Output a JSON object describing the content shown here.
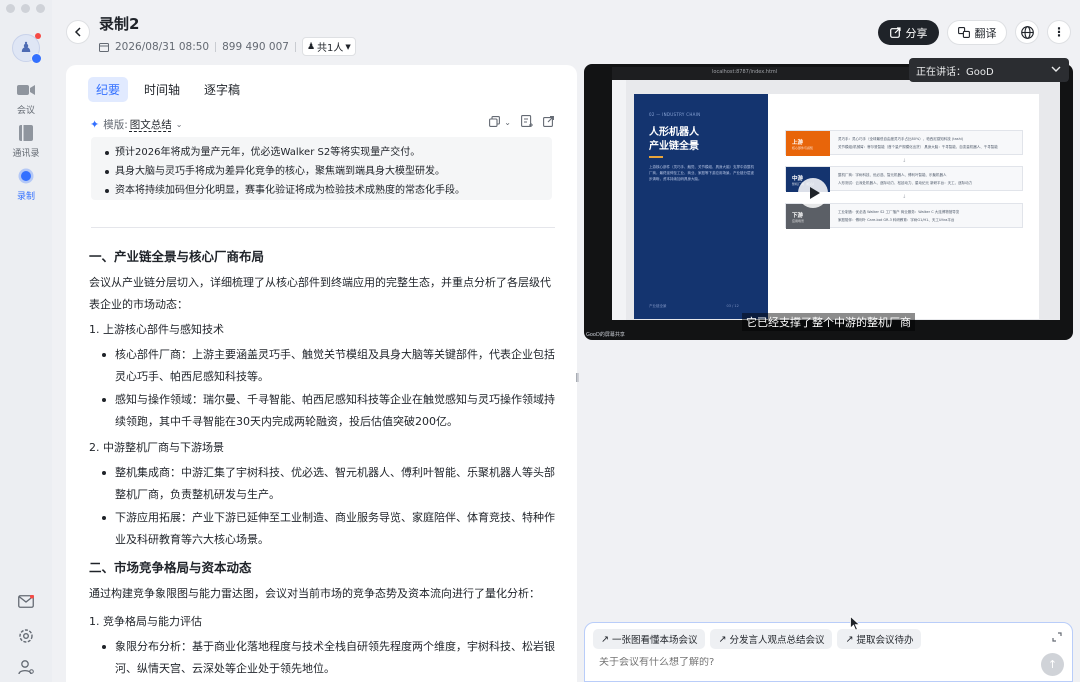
{
  "rail": {
    "items": [
      {
        "label": "会议",
        "icon": "video-camera-icon"
      },
      {
        "label": "通讯录",
        "icon": "contacts-book-icon"
      },
      {
        "label": "录制",
        "icon": "record-dot-icon"
      }
    ]
  },
  "header": {
    "title": "录制2",
    "datetime": "2026/08/31 08:50",
    "meeting_id": "899 490 007",
    "people": "共1人",
    "share_label": "分享",
    "translate_label": "翻译"
  },
  "panel": {
    "tabs": [
      "纪要",
      "时间轴",
      "逐字稿"
    ],
    "template_label": "模版:",
    "template_value": "图文总结",
    "summary": [
      "预计2026年将成为量产元年，优必选Walker S2等将实现量产交付。",
      "具身大脑与灵巧手将成为差异化竞争的核心，聚焦端到端具身大模型研发。",
      "资本将持续加码但分化明显，赛事化验证将成为检验技术成熟度的常态化手段。"
    ],
    "section1": {
      "heading": "一、产业链全景与核心厂商布局",
      "intro": "会议从产业链分层切入，详细梳理了从核心部件到终端应用的完整生态，并重点分析了各层级代表企业的市场动态：",
      "sub1": "1. 上游核心部件与感知技术",
      "sub1_bullets": [
        "核心部件厂商：上游主要涵盖灵巧手、触觉关节模组及具身大脑等关键部件，代表企业包括灵心巧手、帕西尼感知科技等。",
        "感知与操作领域：瑞尔曼、千寻智能、帕西尼感知科技等企业在触觉感知与灵巧操作领域持续领跑，其中千寻智能在30天内完成两轮融资，投后估值突破200亿。"
      ],
      "sub2": "2. 中游整机厂商与下游场景",
      "sub2_bullets": [
        "整机集成商：中游汇集了宇树科技、优必选、智元机器人、傅利叶智能、乐聚机器人等头部整机厂商，负责整机研发与生产。",
        "下游应用拓展：产业下游已延伸至工业制造、商业服务导览、家庭陪伴、体育竞技、特种作业及科研教育等六大核心场景。"
      ]
    },
    "section2": {
      "heading": "二、市场竞争格局与资本动态",
      "intro": "通过构建竞争象限图与能力雷达图，会议对当前市场的竞争态势及资本流向进行了量化分析：",
      "sub1": "1. 竞争格局与能力评估",
      "sub1_bullets": [
        "象限分布分析：基于商业化落地程度与技术全栈自研领先程度两个维度，宇树科技、松岩银河、纵情天宫、云深处等企业处于领先地位。"
      ]
    }
  },
  "video": {
    "url": "localhost:8787/index.html",
    "speaking_label": "正在讲话：GooD",
    "subtitle": "它已经支撑了整个中游的整机厂商",
    "watermark": "GooD的屏幕共享",
    "slide": {
      "tag": "02 — INDUSTRY CHAIN",
      "title_line1": "人形机器人",
      "title_line2": "产业链全景",
      "desc": "上游核心部件（灵巧手、触觉、关节模组、具身大脑）支撑中游整机厂商，最终延伸至工业、商业、家庭等下游应用场景。产业链分层逐步清晰，资本持续加码具身大脑。",
      "footer": "产业链全景",
      "page": "03 / 12",
      "tiers": [
        {
          "name": "上游",
          "sub": "核心部件与感知",
          "color": "#e8650a",
          "line1": "灵巧手：灵心巧手（全球最低自由度灵巧手占比80%）、帕西尼感知科技 (tashi)",
          "line2": "关节模组/机械臂：睿尔曼智能（首个量产规模化出货）   具身大脑：千寻智能、自变量机器人、千寻智能"
        },
        {
          "name": "中游",
          "sub": "整机厂商（核心）",
          "color": "#14346f",
          "line1": "整机厂商：宇树科技、优必选、智元机器人、傅利叶智能、乐聚机器人",
          "line2": "人形测试：云深处机器人、逐际动力、松延动力、星动纪元   新研平台：天工、逐际动力"
        },
        {
          "name": "下游",
          "sub": "应用场景",
          "color": "#5b5f66",
          "line1": "工业制造：优必选 Walker S2 工厂落户   商业服务：Walker C 大连博物馆导览",
          "line2": "家庭陪伴：傅利叶 Care-bot GR-3   科研教育：宇树G1/H1、天工Ultra平台"
        }
      ]
    }
  },
  "chat": {
    "chips": [
      "一张图看懂本场会议",
      "分发言人观点总结会议",
      "提取会议待办"
    ],
    "placeholder": "关于会议有什么想了解的?"
  }
}
